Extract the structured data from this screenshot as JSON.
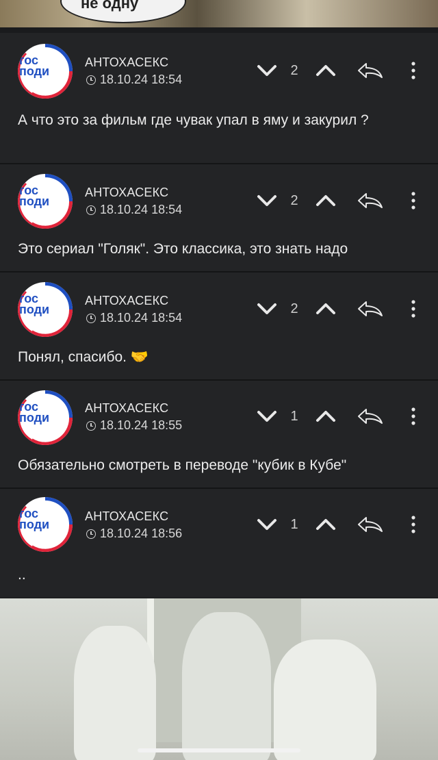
{
  "top_image": {
    "caption": "не одну"
  },
  "comments": [
    {
      "author": "АНТОХАСЕКС",
      "timestamp": "18.10.24 18:54",
      "score": "2",
      "text": "А что это за фильм где чувак упал в яму и закурил ?",
      "avatar_lines": [
        "гос",
        "поди"
      ]
    },
    {
      "author": "АНТОХАСЕКС",
      "timestamp": "18.10.24 18:54",
      "score": "2",
      "text": "Это сериал \"Голяк\". Это классика, это знать надо",
      "avatar_lines": [
        "гос",
        "поди"
      ]
    },
    {
      "author": "АНТОХАСЕКС",
      "timestamp": "18.10.24 18:54",
      "score": "2",
      "text": "Понял, спасибо. 🤝",
      "avatar_lines": [
        "гос",
        "поди"
      ]
    },
    {
      "author": "АНТОХАСЕКС",
      "timestamp": "18.10.24 18:55",
      "score": "1",
      "text": "Обязательно смотреть в переводе \"кубик в Кубе\"",
      "avatar_lines": [
        "гос",
        "поди"
      ]
    },
    {
      "author": "АНТОХАСЕКС",
      "timestamp": "18.10.24 18:56",
      "score": "1",
      "text": "..",
      "avatar_lines": [
        "гос",
        "поди"
      ]
    }
  ],
  "icons": {
    "vote_down": "chevron-down-icon",
    "vote_up": "chevron-up-icon",
    "reply": "reply-arrow-icon",
    "more": "more-vertical-icon",
    "time": "clock-icon"
  },
  "colors": {
    "background": "#1e1f21",
    "card": "#232426",
    "avatar_blue": "#1f4fc1",
    "avatar_red": "#e0243a"
  }
}
